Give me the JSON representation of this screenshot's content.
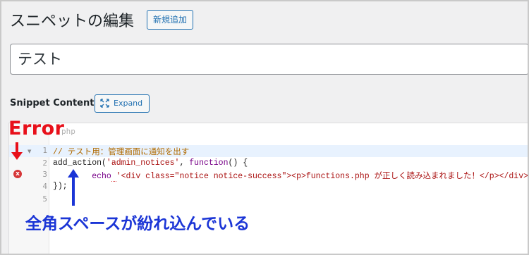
{
  "page": {
    "title": "スニペットの編集",
    "add_new_label": "新規追加",
    "snippet_title": "テスト",
    "snippet_content_label": "Snippet Content",
    "expand_label": "Expand"
  },
  "editor": {
    "mode_hint": "php",
    "line_numbers": [
      "1",
      "2",
      "3",
      "4",
      "5"
    ],
    "lines": {
      "l1": "// テスト用：管理画面に通知を出す",
      "l2_fn": "add_action",
      "l2_open": "(",
      "l2_arg": "'admin_notices'",
      "l2_sep": ", ",
      "l2_kw": "function",
      "l2_rest": "() {",
      "l3_indent": "        ",
      "l3_echo": "echo",
      "l3_space": " ",
      "l3_str": "'<div class=\"notice notice-success\"><p>functions.php が正しく読み込まれました！</p></div>'",
      "l3_end": ";",
      "l4": "});"
    },
    "error_marker": "x"
  },
  "annotations": {
    "error_label": "Error",
    "fullwidth_space_note": "全角スペースが紛れ込んでいる",
    "colors": {
      "red": "#e8101a",
      "blue": "#1b35d6"
    }
  }
}
